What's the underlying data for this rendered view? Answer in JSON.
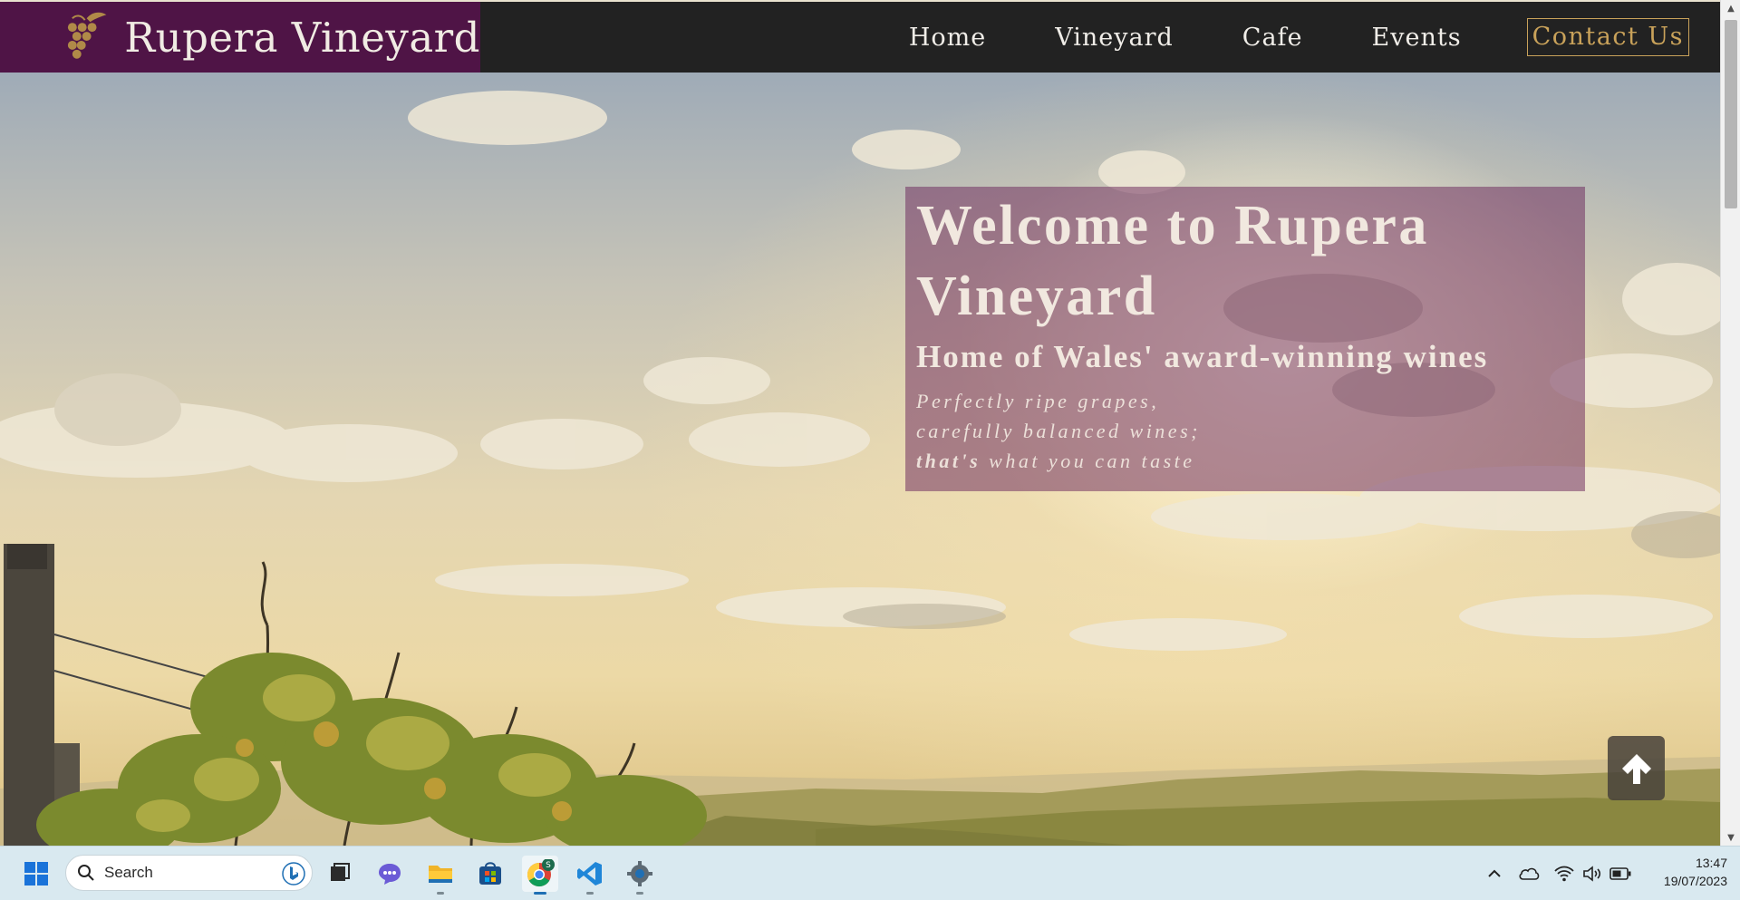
{
  "site": {
    "brand_name": "Rupera Vineyard",
    "nav": [
      {
        "label": "Home"
      },
      {
        "label": "Vineyard"
      },
      {
        "label": "Cafe"
      },
      {
        "label": "Events"
      }
    ],
    "cta_label": "Contact Us"
  },
  "hero": {
    "title": "Welcome to Rupera Vineyard",
    "subtitle": "Home of Wales' award-winning wines",
    "tagline": {
      "line1": "Perfectly ripe grapes,",
      "line2": "carefully balanced wines;",
      "line3_bold": "that's",
      "line3_rest": " what you can taste"
    }
  },
  "taskbar": {
    "search_placeholder": "Search",
    "apps": [
      {
        "icon": "windows-start-icon"
      },
      {
        "icon": "task-view-icon"
      },
      {
        "icon": "teams-chat-icon"
      },
      {
        "icon": "file-explorer-icon"
      },
      {
        "icon": "microsoft-store-icon"
      },
      {
        "icon": "chrome-icon",
        "badge": "S"
      },
      {
        "icon": "vscode-icon"
      },
      {
        "icon": "settings-icon"
      }
    ],
    "time": "13:47",
    "date": "19/07/2023"
  },
  "colors": {
    "brand_purple": "#4f1446",
    "header_dark": "#222222",
    "accent_gold": "#c9a25a",
    "card_overlay": "#6b285c"
  }
}
